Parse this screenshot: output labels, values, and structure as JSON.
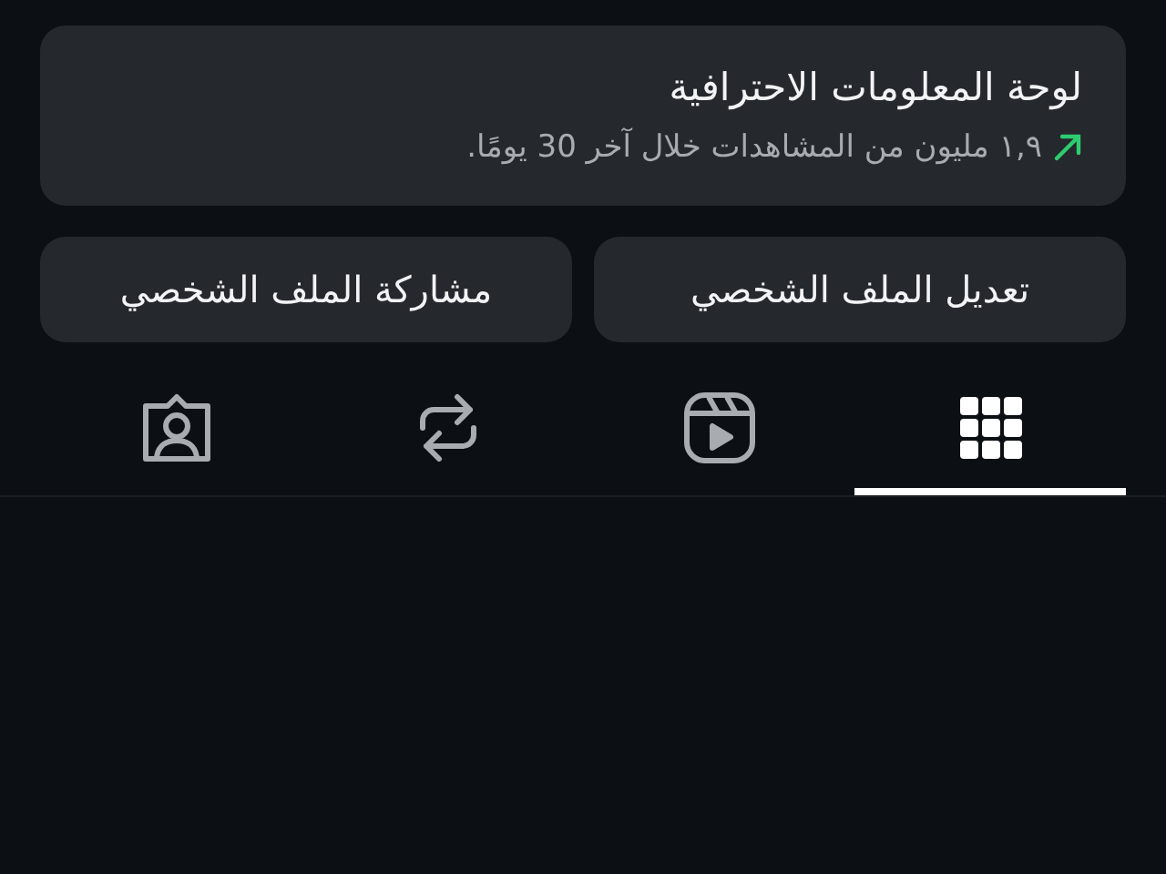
{
  "dashboard": {
    "title": "لوحة المعلومات الاحترافية",
    "stat": "١,٩ مليون من المشاهدات خلال آخر 30 يومًا."
  },
  "buttons": [
    "تعديل الملف الشخصي",
    "مشاركة الملف الشخصي"
  ],
  "tabs": [
    {
      "kind": "grid",
      "selected": true
    },
    {
      "kind": "reels",
      "selected": false
    },
    {
      "kind": "reposts",
      "selected": false
    },
    {
      "kind": "tagged",
      "selected": false
    }
  ]
}
